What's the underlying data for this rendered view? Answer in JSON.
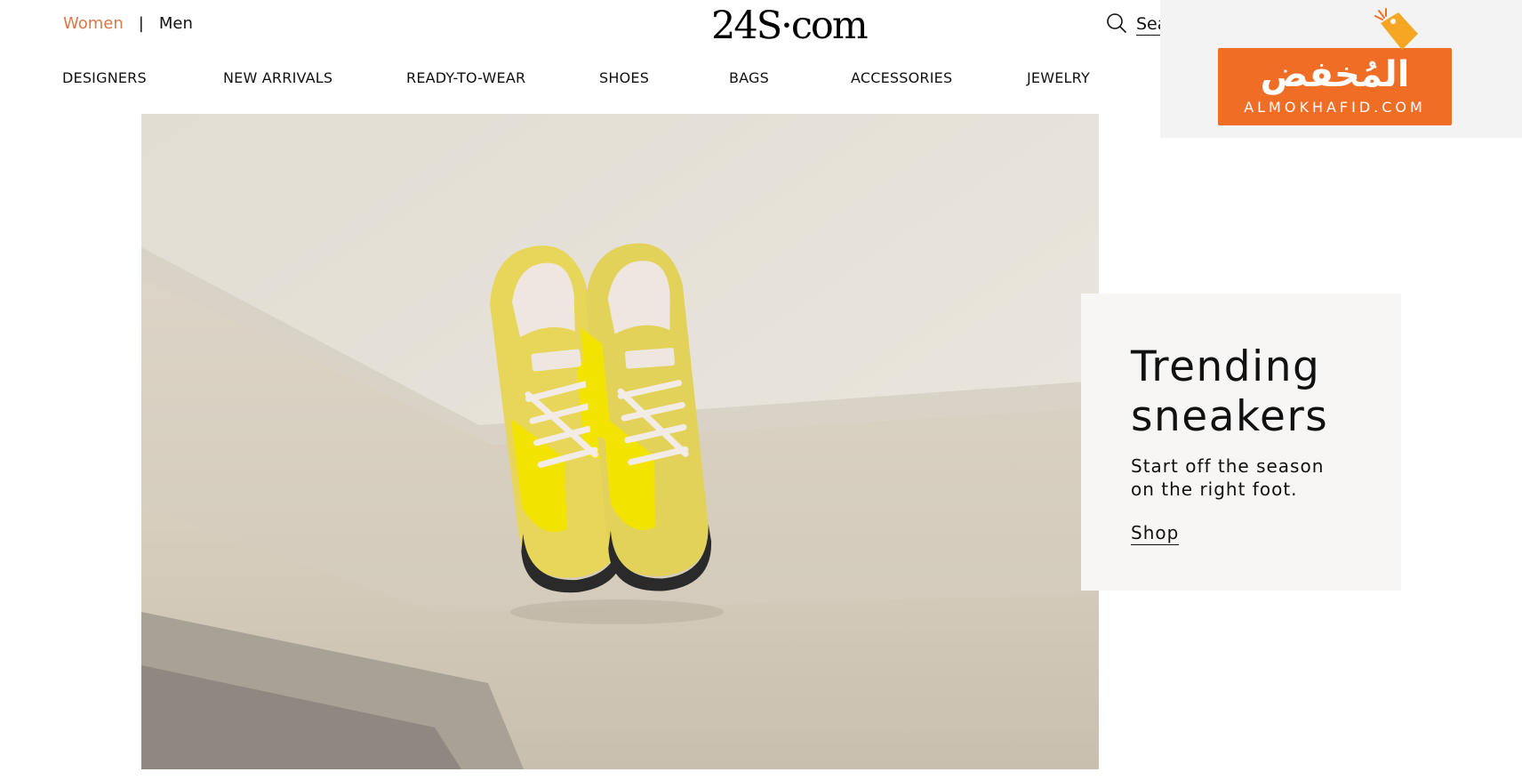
{
  "header": {
    "gender": {
      "women": "Women",
      "separator": "|",
      "men": "Men"
    },
    "logo": "24S·com",
    "search": {
      "label": "Search",
      "icon": "search-icon"
    }
  },
  "nav": {
    "items": [
      {
        "label": "DESIGNERS"
      },
      {
        "label": "NEW ARRIVALS"
      },
      {
        "label": "READY-TO-WEAR"
      },
      {
        "label": "SHOES"
      },
      {
        "label": "BAGS"
      },
      {
        "label": "ACCESSORIES"
      },
      {
        "label": "JEWELRY"
      }
    ]
  },
  "ad": {
    "arabic": "المُخفض",
    "latin": "ALMOKHAFID.COM",
    "brand_color": "#f06d25"
  },
  "hero": {
    "image": "yellow-sneakers-photo"
  },
  "promo": {
    "title_line1": "Trending",
    "title_line2": "sneakers",
    "description": "Start off the season on the right foot.",
    "cta": "Shop"
  },
  "colors": {
    "accent": "#d9784b",
    "text": "#111111",
    "card_bg": "#f7f6f4"
  }
}
